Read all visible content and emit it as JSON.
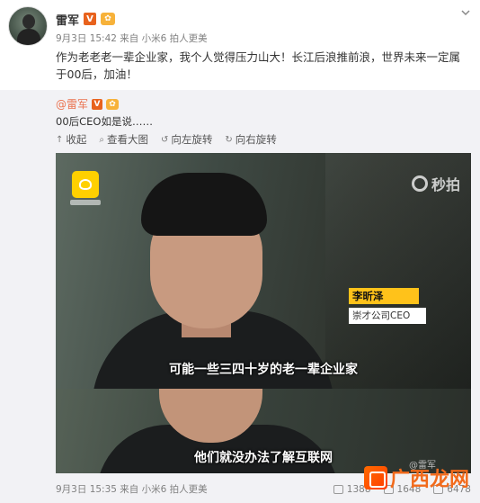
{
  "post": {
    "author": "雷军",
    "verified_badge": "V",
    "member_badge": "✿",
    "meta": "9月3日 15:42 来自 小米6 拍人更美",
    "text": "作为老老老一辈企业家，我个人觉得压力山大！长江后浪推前浪，世界未来一定属于00后，加油！"
  },
  "repost": {
    "author": "@雷军",
    "text": "00后CEO如是说……",
    "toolbar": {
      "collapse": "收起",
      "view_large": "查看大图",
      "rotate_left": "向左旋转",
      "rotate_right": "向右旋转"
    },
    "media": {
      "brand": "秒拍",
      "person_name": "李昕泽",
      "person_title": "崇才公司CEO",
      "subtitle_1": "可能一些三四十岁的老一辈企业家",
      "subtitle_2": "他们就没办法了解互联网"
    },
    "footer": {
      "meta": "9月3日 15:35 来自 小米6 拍人更美",
      "share_count": "1388",
      "comment_count": "1648",
      "like_count": "6478"
    }
  },
  "watermark": {
    "brand": "广西龙网",
    "small": "@雷军"
  },
  "colors": {
    "link": "#eb7350",
    "meta": "#808080",
    "repost_bg": "#f2f2f5",
    "tag_yellow": "#ffc21a",
    "watermark": "#f26a1b"
  },
  "icons": [
    "chevron-down-icon",
    "collapse-icon",
    "zoom-icon",
    "rotate-left-icon",
    "rotate-right-icon",
    "share-icon",
    "comment-icon",
    "like-icon"
  ]
}
